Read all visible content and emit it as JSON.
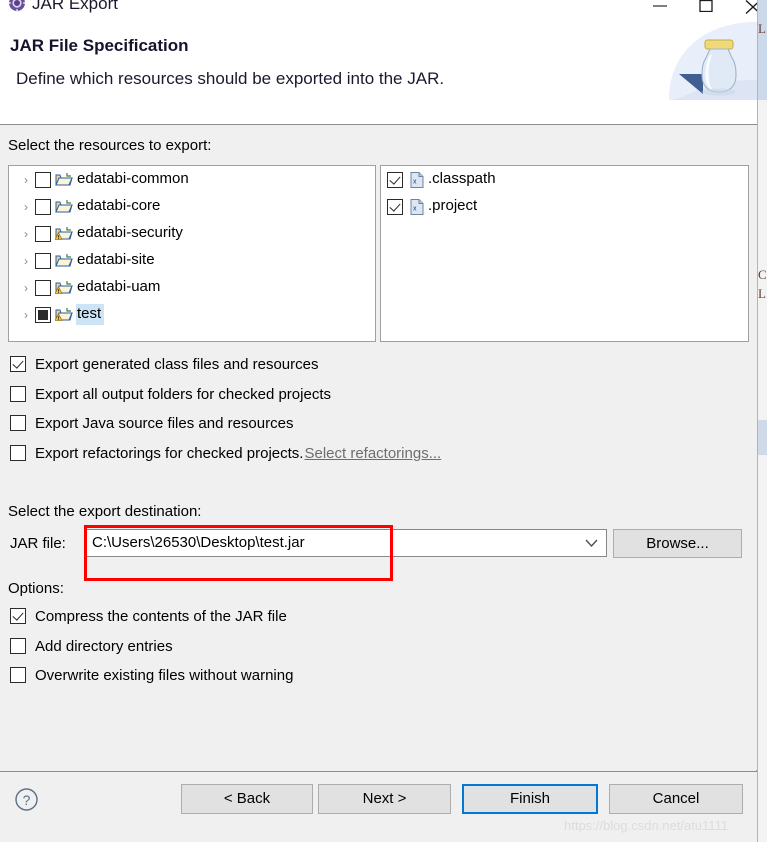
{
  "window": {
    "title": "JAR Export",
    "icon": "jar-export-icon",
    "controls": {
      "minimize": "minimize-icon",
      "maximize": "maximize-icon",
      "close": "close-icon"
    }
  },
  "header": {
    "title": "JAR File Specification",
    "description": "Define which resources should be exported into the JAR.",
    "banner_icon": "jar-bottle-icon"
  },
  "resources": {
    "label": "Select the resources to export:",
    "projects": [
      {
        "name": "edatabi-common",
        "checked": "unchecked",
        "icon": "project-folder-icon",
        "selected": false,
        "expandable": true
      },
      {
        "name": "edatabi-core",
        "checked": "unchecked",
        "icon": "project-folder-icon",
        "selected": false,
        "expandable": true
      },
      {
        "name": "edatabi-security",
        "checked": "unchecked",
        "icon": "project-folder-warning-icon",
        "selected": false,
        "expandable": true
      },
      {
        "name": "edatabi-site",
        "checked": "unchecked",
        "icon": "project-folder-icon",
        "selected": false,
        "expandable": true
      },
      {
        "name": "edatabi-uam",
        "checked": "unchecked",
        "icon": "project-folder-warning-icon",
        "selected": false,
        "expandable": true
      },
      {
        "name": "test",
        "checked": "partial",
        "icon": "project-folder-warning-icon",
        "selected": true,
        "expandable": true
      }
    ],
    "files": [
      {
        "name": ".classpath",
        "checked": "checked",
        "icon": "xml-file-icon"
      },
      {
        "name": ".project",
        "checked": "checked",
        "icon": "xml-file-icon"
      }
    ]
  },
  "export_options": [
    {
      "label": "Export generated class files and resources",
      "checked": "checked"
    },
    {
      "label": "Export all output folders for checked projects",
      "checked": "unchecked"
    },
    {
      "label": "Export Java source files and resources",
      "checked": "unchecked"
    },
    {
      "label": "Export refactorings for checked projects.",
      "checked": "unchecked",
      "link": "Select refactorings..."
    }
  ],
  "destination": {
    "label": "Select the export destination:",
    "jar_file_label": "JAR file:",
    "jar_file_value": "C:\\Users\\26530\\Desktop\\test.jar",
    "browse_label": "Browse...",
    "dropdown_icon": "chevron-down-icon",
    "annotation_color": "#ff0000"
  },
  "options": {
    "label": "Options:",
    "items": [
      {
        "label": "Compress the contents of the JAR file",
        "checked": "checked"
      },
      {
        "label": "Add directory entries",
        "checked": "unchecked"
      },
      {
        "label": "Overwrite existing files without warning",
        "checked": "unchecked"
      }
    ]
  },
  "footer": {
    "help_icon": "help-question-icon",
    "buttons": [
      {
        "label": "< Back",
        "default": false
      },
      {
        "label": "Next >",
        "default": false
      },
      {
        "label": "Finish",
        "default": true
      },
      {
        "label": "Cancel",
        "default": false
      }
    ]
  },
  "watermark": "https://blog.csdn.net/atu1111"
}
